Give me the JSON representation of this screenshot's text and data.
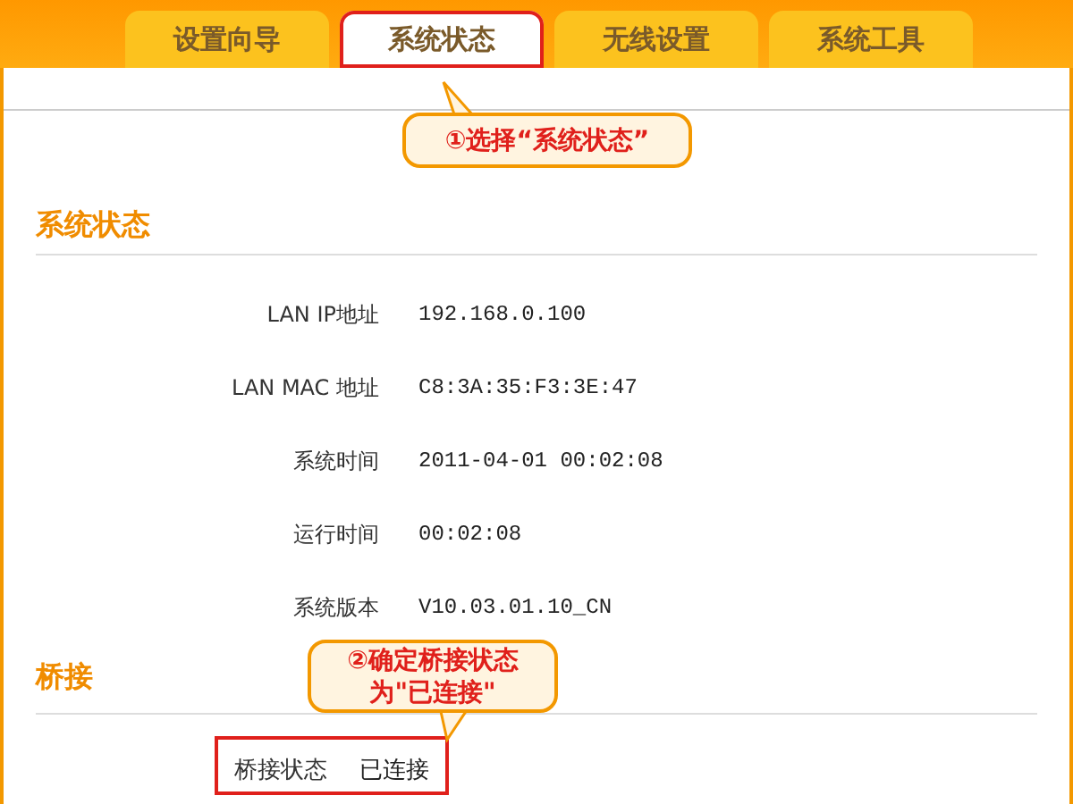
{
  "tabs": [
    {
      "label": "设置向导",
      "selected": false,
      "highlighted": false
    },
    {
      "label": "系统状态",
      "selected": true,
      "highlighted": true
    },
    {
      "label": "无线设置",
      "selected": false,
      "highlighted": false
    },
    {
      "label": "系统工具",
      "selected": false,
      "highlighted": false
    }
  ],
  "callouts": [
    {
      "lines": [
        "①选择“系统状态”"
      ]
    },
    {
      "lines": [
        "②确定桥接状态",
        "为\"已连接\""
      ]
    }
  ],
  "sections": [
    {
      "title": "系统状态",
      "rows": [
        {
          "label": "LAN IP地址",
          "value": "192.168.0.100",
          "highlighted": false
        },
        {
          "label": "LAN MAC 地址",
          "value": "C8:3A:35:F3:3E:47",
          "highlighted": false
        },
        {
          "label": "系统时间",
          "value": "2011-04-01 00:02:08",
          "highlighted": false
        },
        {
          "label": "运行时间",
          "value": "00:02:08",
          "highlighted": false
        },
        {
          "label": "系统版本",
          "value": "V10.03.01.10_CN",
          "highlighted": false
        }
      ]
    },
    {
      "title": "桥接",
      "rows": [
        {
          "label": "桥接状态",
          "value": "已连接",
          "highlighted": true
        }
      ]
    }
  ]
}
